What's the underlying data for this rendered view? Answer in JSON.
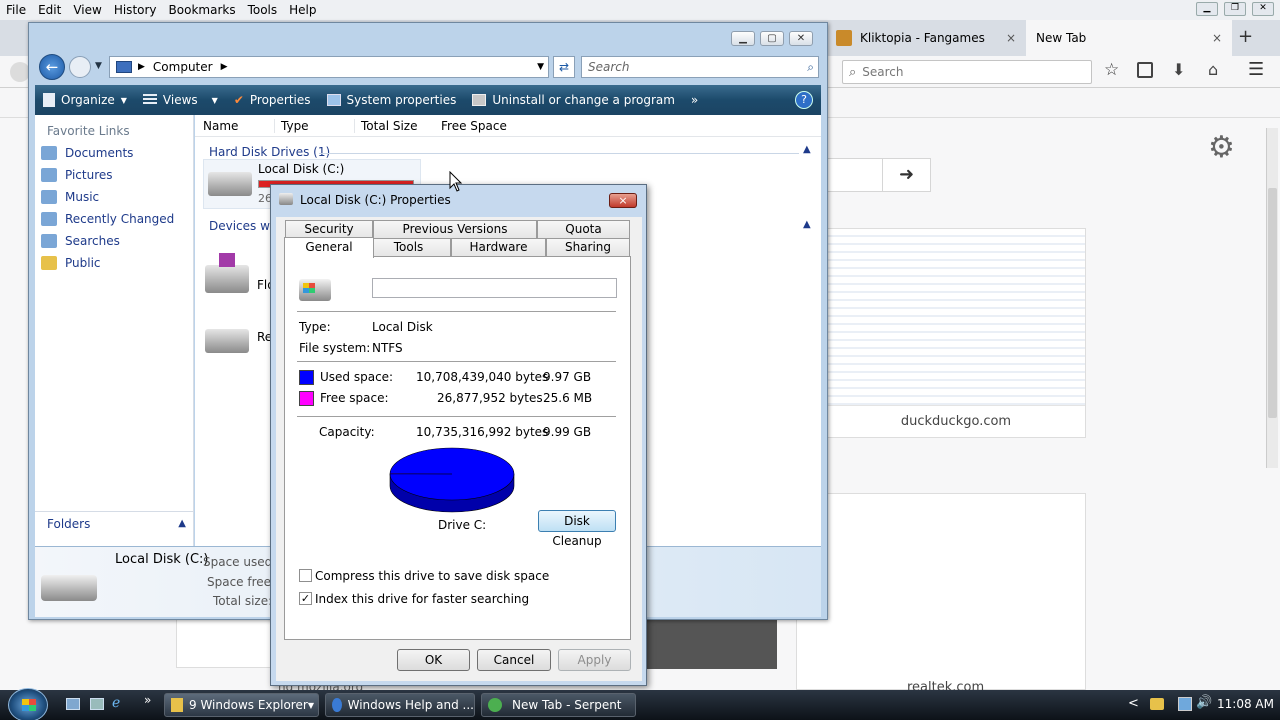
{
  "browser": {
    "menu": [
      "File",
      "Edit",
      "View",
      "History",
      "Bookmarks",
      "Tools",
      "Help"
    ],
    "tabs": [
      {
        "label": "Kliktopia - Fangames",
        "close": "×"
      },
      {
        "label": "New Tab",
        "close": "×"
      }
    ],
    "new_tab": "+",
    "search_placeholder": "Search",
    "tiles": [
      {
        "label": "duckduckgo.com"
      },
      {
        "label": "realtek.com"
      }
    ],
    "partial_link": "nd mozilla.org"
  },
  "explorer": {
    "address": "Computer",
    "search_placeholder": "Search",
    "toolbar": {
      "organize": "Organize",
      "views": "Views",
      "properties": "Properties",
      "system_properties": "System properties",
      "uninstall": "Uninstall or change a program",
      "more": "»",
      "help": "?"
    },
    "favorite_links_title": "Favorite Links",
    "links": [
      "Documents",
      "Pictures",
      "Music",
      "Recently Changed",
      "Searches",
      "Public"
    ],
    "folders": "Folders",
    "columns": [
      "Name",
      "Type",
      "Total Size",
      "Free Space"
    ],
    "group_hdd": "Hard Disk Drives (1)",
    "group_devices": "Devices with",
    "drive_name": "Local Disk (C:)",
    "drive_sub": "26",
    "device1": "Flo",
    "device2": "Re",
    "details": {
      "name": "Local Disk (C:)",
      "space_used": "Space used:",
      "space_free": "Space free:",
      "total_size": "Total size:"
    }
  },
  "dialog": {
    "title": "Local Disk (C:) Properties",
    "close": "×",
    "tabs_back": [
      "Security",
      "Previous Versions",
      "Quota"
    ],
    "tabs_front": [
      "General",
      "Tools",
      "Hardware",
      "Sharing"
    ],
    "label_value": "",
    "type_label": "Type:",
    "type_value": "Local Disk",
    "fs_label": "File system:",
    "fs_value": "NTFS",
    "used_label": "Used space:",
    "used_bytes": "10,708,439,040 bytes",
    "used_gb": "9.97 GB",
    "free_label": "Free space:",
    "free_bytes": "26,877,952 bytes",
    "free_mb": "25.6 MB",
    "cap_label": "Capacity:",
    "cap_bytes": "10,735,316,992 bytes",
    "cap_gb": "9.99 GB",
    "used_color": "#0000ff",
    "free_color": "#ff00ff",
    "used_fraction": 0.9975,
    "drive_label": "Drive C:",
    "cleanup": "Disk Cleanup",
    "compress": "Compress this drive to save disk space",
    "compress_checked": false,
    "index": "Index this drive for faster searching",
    "index_checked": true,
    "ok": "OK",
    "cancel": "Cancel",
    "apply": "Apply"
  },
  "taskbar": {
    "items": [
      {
        "label": "9 Windows Explorer"
      },
      {
        "label": "Windows Help and ..."
      },
      {
        "label": "New Tab - Serpent"
      }
    ],
    "chevron": "»",
    "tray_arrow": "<",
    "clock": "11:08 AM"
  }
}
